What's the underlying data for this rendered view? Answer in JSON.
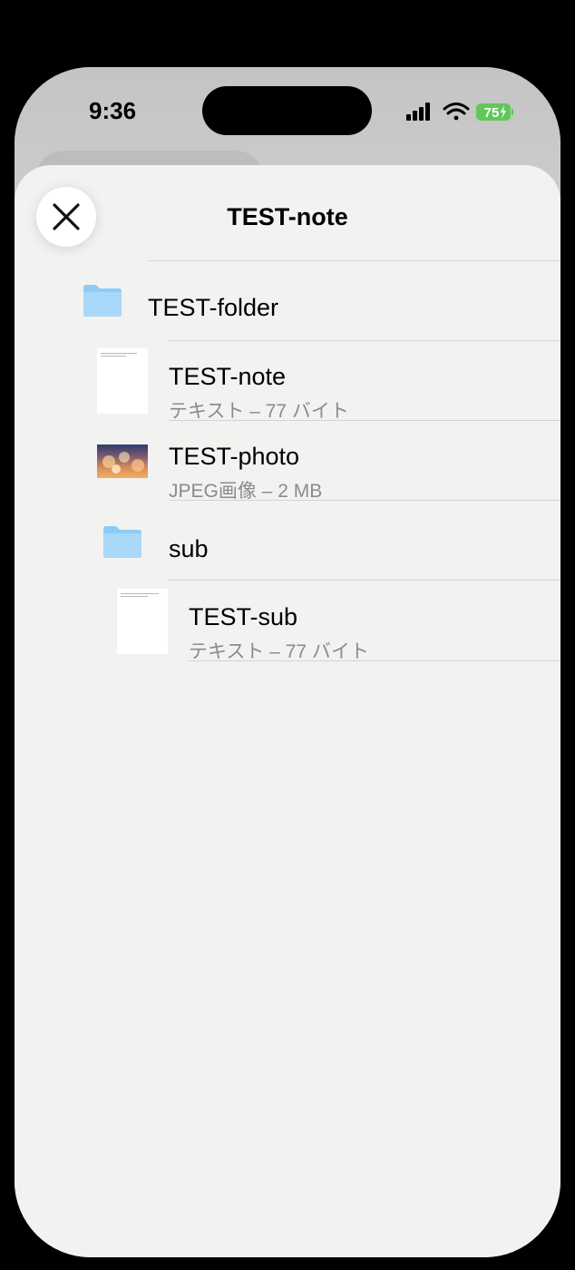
{
  "status_bar": {
    "time": "9:36",
    "battery": "75"
  },
  "sheet": {
    "title": "TEST-note",
    "close_icon": "close-icon"
  },
  "items": [
    {
      "kind": "folder",
      "name": "TEST-folder",
      "subtitle": ""
    },
    {
      "kind": "text",
      "name": "TEST-note",
      "subtitle": "テキスト – 77 バイト"
    },
    {
      "kind": "image",
      "name": "TEST-photo",
      "subtitle": "JPEG画像 – 2 MB"
    },
    {
      "kind": "folder",
      "name": "sub",
      "subtitle": ""
    },
    {
      "kind": "text",
      "name": "TEST-sub",
      "subtitle": "テキスト – 77 バイト"
    }
  ],
  "colors": {
    "folder": "#8fccf5",
    "battery": "#5fc85a",
    "sheet": "#f2f2f0"
  }
}
